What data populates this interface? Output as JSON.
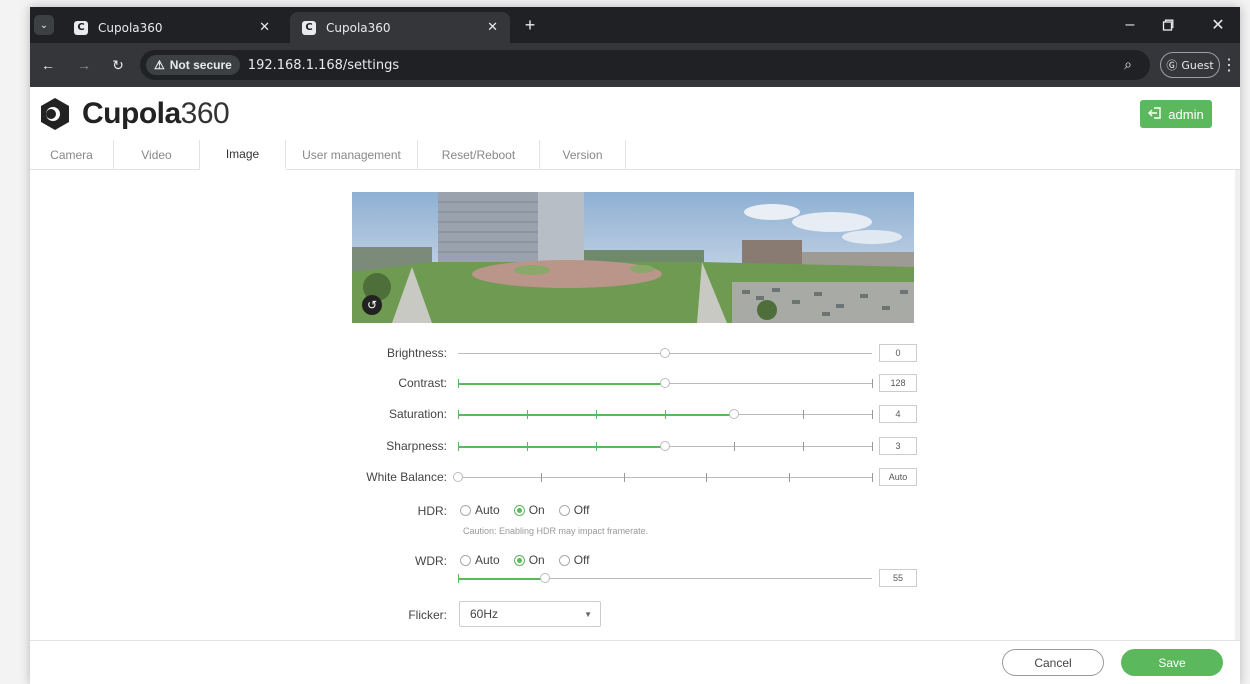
{
  "browser": {
    "tabs": [
      {
        "title": "Cupola360",
        "favicon": "C"
      },
      {
        "title": "Cupola360",
        "favicon": "C"
      }
    ],
    "security_label": "Not secure",
    "url": "192.168.1.168/settings",
    "profile_label": "Guest"
  },
  "header": {
    "logo_bold": "Cupola",
    "logo_thin": "360",
    "user_label": "admin"
  },
  "settings_tabs": [
    {
      "label": "Camera"
    },
    {
      "label": "Video"
    },
    {
      "label": "Image",
      "active": true
    },
    {
      "label": "User management"
    },
    {
      "label": "Reset/Reboot"
    },
    {
      "label": "Version"
    }
  ],
  "image_settings": {
    "brightness": {
      "label": "Brightness:",
      "value": "0",
      "level": 0.5
    },
    "contrast": {
      "label": "Contrast:",
      "value": "128",
      "level": 0.5
    },
    "saturation": {
      "label": "Saturation:",
      "value": "4",
      "level": 0.667
    },
    "sharpness": {
      "label": "Sharpness:",
      "value": "3",
      "level": 0.5
    },
    "white_balance": {
      "label": "White Balance:",
      "value": "Auto",
      "level": 0
    },
    "hdr": {
      "label": "HDR:",
      "options": [
        "Auto",
        "On",
        "Off"
      ],
      "selected": "On",
      "caution": "Caution: Enabling HDR may impact framerate."
    },
    "wdr": {
      "label": "WDR:",
      "options": [
        "Auto",
        "On",
        "Off"
      ],
      "selected": "On",
      "value": "55",
      "level": 0.21
    },
    "flicker": {
      "label": "Flicker:",
      "selected": "60Hz"
    }
  },
  "footer": {
    "cancel_label": "Cancel",
    "save_label": "Save"
  },
  "colors": {
    "accent": "#5cb85c",
    "chrome_dark": "#202124",
    "chrome_mid": "#35363a"
  }
}
